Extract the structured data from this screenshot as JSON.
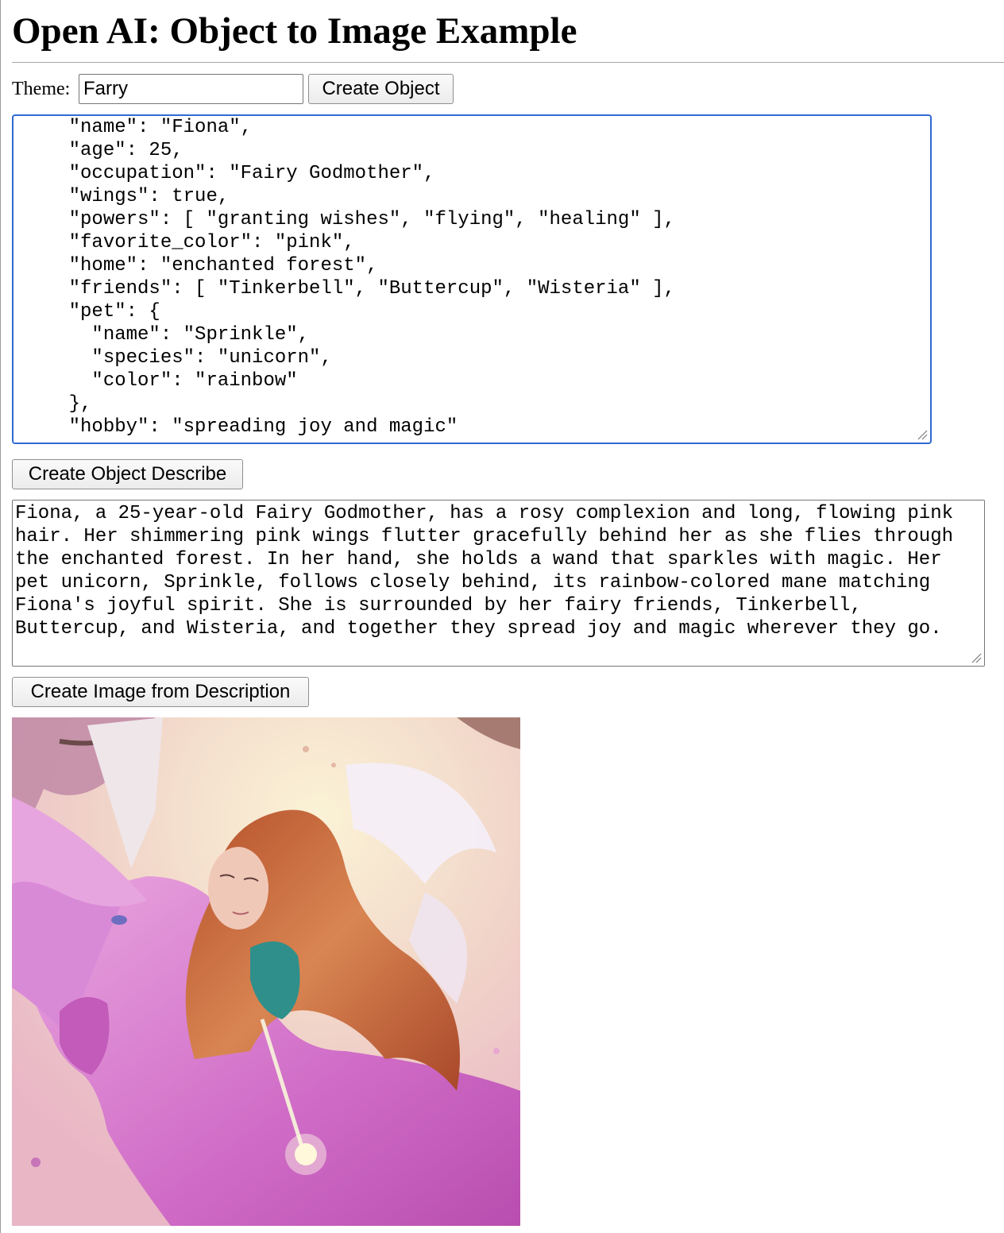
{
  "page": {
    "title": "Open AI: Object to Image Example"
  },
  "theme": {
    "label": "Theme:",
    "value": "Farry"
  },
  "buttons": {
    "create_object": "Create Object",
    "create_describe": "Create Object Describe",
    "create_image": "Create Image from Description"
  },
  "object_json": {
    "text": "    \"name\": \"Fiona\",\n    \"age\": 25,\n    \"occupation\": \"Fairy Godmother\",\n    \"wings\": true,\n    \"powers\": [ \"granting wishes\", \"flying\", \"healing\" ],\n    \"favorite_color\": \"pink\",\n    \"home\": \"enchanted forest\",\n    \"friends\": [ \"Tinkerbell\", \"Buttercup\", \"Wisteria\" ],\n    \"pet\": {\n      \"name\": \"Sprinkle\",\n      \"species\": \"unicorn\",\n      \"color\": \"rainbow\"\n    },\n    \"hobby\": \"spreading joy and magic\""
  },
  "description": {
    "text": "Fiona, a 25-year-old Fairy Godmother, has a rosy complexion and long, flowing pink hair. Her shimmering pink wings flutter gracefully behind her as she flies through the enchanted forest. In her hand, she holds a wand that sparkles with magic. Her pet unicorn, Sprinkle, follows closely behind, its rainbow-colored mane matching Fiona's joyful spirit. She is surrounded by her fairy friends, Tinkerbell, Buttercup, and Wisteria, and together they spread joy and magic wherever they go."
  },
  "colors": {
    "focus_border": "#2f6bd1",
    "unicorn_pink": "#d77fd0",
    "hair_orange": "#c8683a"
  }
}
